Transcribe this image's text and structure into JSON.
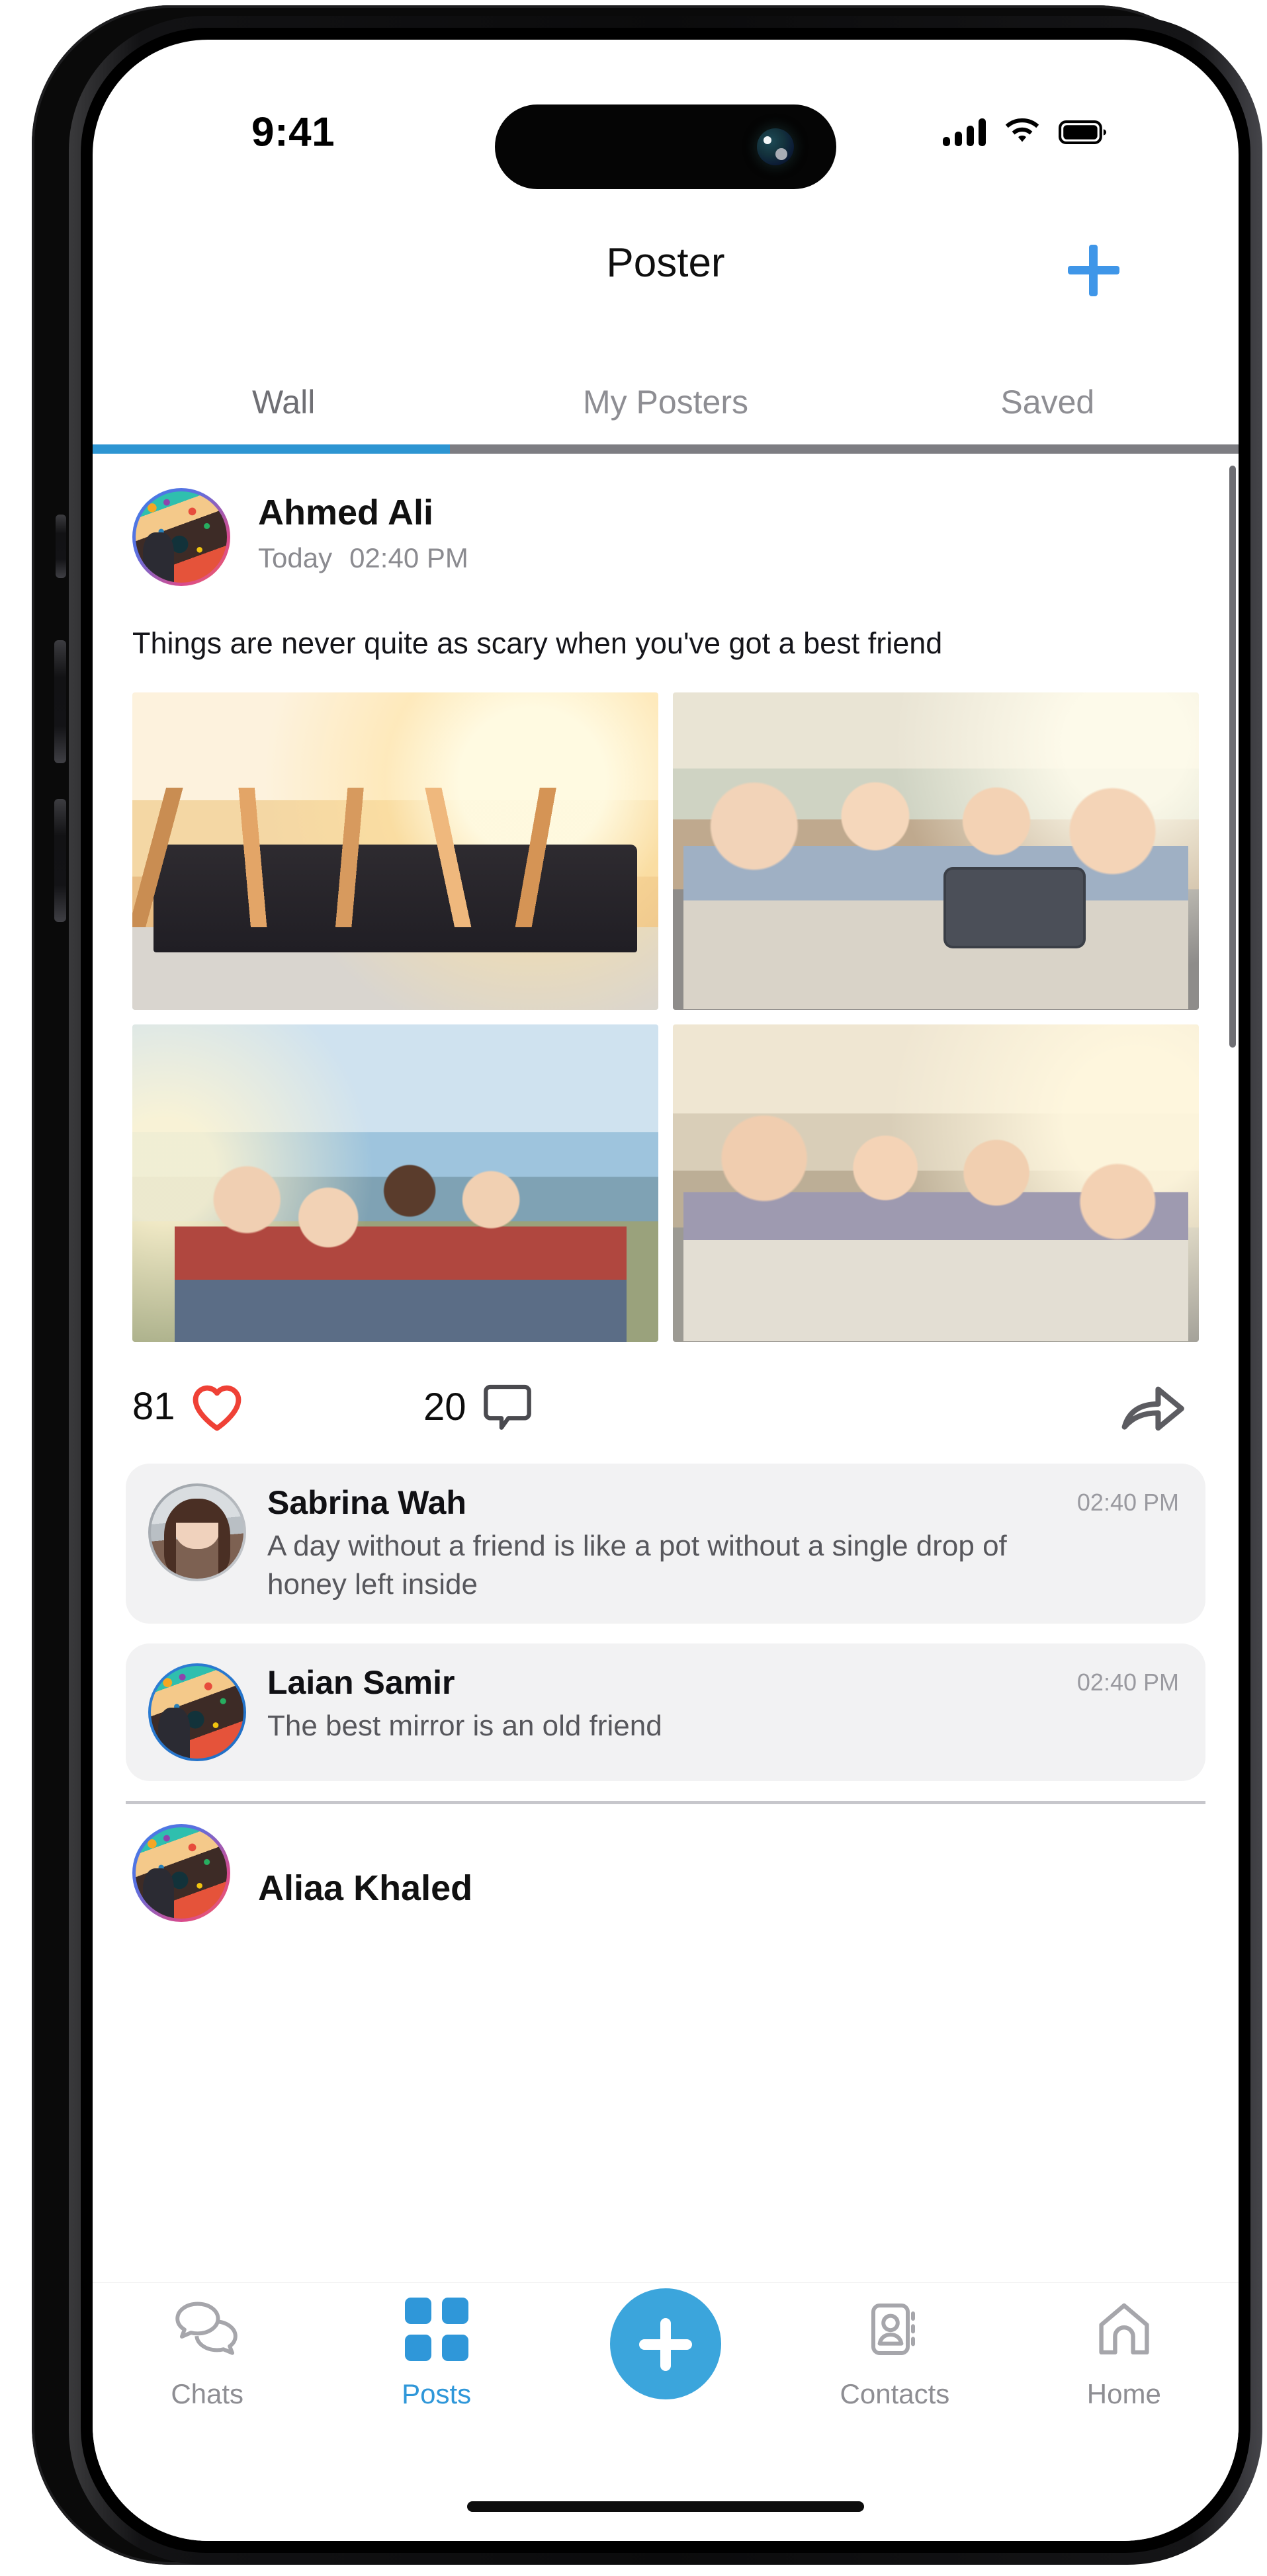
{
  "status_bar": {
    "time": "9:41",
    "cellular_icon": "cellular-signal-icon",
    "wifi_icon": "wifi-icon",
    "battery_icon": "battery-full-icon"
  },
  "header": {
    "title": "Poster",
    "add_icon": "plus-icon",
    "accent_color": "#3f96e8"
  },
  "tabs": {
    "items": [
      {
        "label": "Wall",
        "active": true
      },
      {
        "label": "My Posters",
        "active": false
      },
      {
        "label": "Saved",
        "active": false
      }
    ],
    "active_indicator_color": "#2d95d2",
    "inactive_indicator_color": "#7d7d82"
  },
  "post": {
    "author": "Ahmed Ali",
    "day": "Today",
    "time": "02:40 PM",
    "text": "Things are never quite as scary when you've got a best friend",
    "photos": [
      {
        "alt": "friends-cheering-in-convertible-at-sunset"
      },
      {
        "alt": "four-friends-taking-selfie-in-car"
      },
      {
        "alt": "group-of-friends-celebrating-by-the-sea"
      },
      {
        "alt": "friends-laughing-together-at-sunset"
      }
    ],
    "likes": "81",
    "like_icon": "heart-icon",
    "like_color": "#ef4136",
    "comments_count": "20",
    "comment_icon": "comment-bubble-icon",
    "share_icon": "share-arrow-icon"
  },
  "comments": [
    {
      "author": "Sabrina Wah",
      "time": "02:40 PM",
      "text": "A day without a friend is like a pot without a single drop of honey left inside"
    },
    {
      "author": "Laian Samir",
      "time": "02:40 PM",
      "text": "The best mirror is an old friend"
    }
  ],
  "next_post": {
    "author": "Aliaa Khaled"
  },
  "bottom_nav": {
    "items": [
      {
        "label": "Chats",
        "icon": "chat-bubbles-icon",
        "active": false
      },
      {
        "label": "Posts",
        "icon": "grid-squares-icon",
        "active": true
      },
      {
        "label": "Contacts",
        "icon": "contact-book-icon",
        "active": false
      },
      {
        "label": "Home",
        "icon": "home-icon",
        "active": false
      }
    ],
    "fab_icon": "plus-icon",
    "fab_color": "#3ba5dc",
    "active_color": "#2f97d9",
    "inactive_color": "#8e8e93"
  }
}
